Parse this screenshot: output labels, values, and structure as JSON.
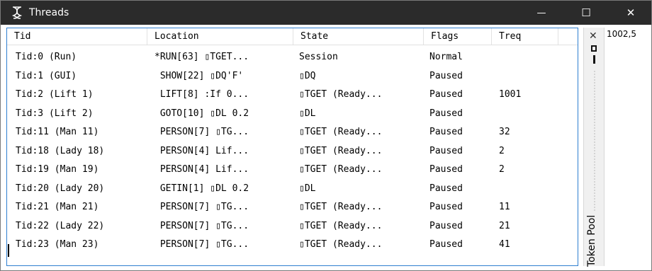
{
  "window": {
    "title": "Threads",
    "controls": {
      "minimize": "—",
      "maximize": "☐",
      "close": "✕"
    }
  },
  "columns": [
    "Tid",
    "Location",
    "State",
    "Flags",
    "Treq"
  ],
  "rows": [
    {
      "tid": "Tid:0 (Run)",
      "location": "*RUN[63] ▯TGET...",
      "state": "Session",
      "flags": "Normal",
      "treq": ""
    },
    {
      "tid": "Tid:1 (GUI)",
      "location": " SHOW[22] ▯DQ'F'",
      "state": "▯DQ",
      "flags": "Paused",
      "treq": ""
    },
    {
      "tid": "Tid:2 (Lift 1)",
      "location": " LIFT[8] :If 0...",
      "state": "▯TGET (Ready...",
      "flags": "Paused",
      "treq": "1001"
    },
    {
      "tid": "Tid:3 (Lift 2)",
      "location": " GOTO[10] ▯DL 0.2",
      "state": "▯DL",
      "flags": "Paused",
      "treq": ""
    },
    {
      "tid": "Tid:11 (Man 11)",
      "location": " PERSON[7] ▯TG...",
      "state": "▯TGET (Ready...",
      "flags": "Paused",
      "treq": "32"
    },
    {
      "tid": "Tid:18 (Lady 18)",
      "location": " PERSON[4] Lif...",
      "state": "▯TGET (Ready...",
      "flags": "Paused",
      "treq": "2"
    },
    {
      "tid": "Tid:19 (Man 19)",
      "location": " PERSON[4] Lif...",
      "state": "▯TGET (Ready...",
      "flags": "Paused",
      "treq": "2"
    },
    {
      "tid": "Tid:20 (Lady 20)",
      "location": " GETIN[1] ▯DL 0.2",
      "state": "▯DL",
      "flags": "Paused",
      "treq": ""
    },
    {
      "tid": "Tid:21 (Man 21)",
      "location": " PERSON[7] ▯TG...",
      "state": "▯TGET (Ready...",
      "flags": "Paused",
      "treq": "11"
    },
    {
      "tid": "Tid:22 (Lady 22)",
      "location": " PERSON[7] ▯TG...",
      "state": "▯TGET (Ready...",
      "flags": "Paused",
      "treq": "21"
    },
    {
      "tid": "Tid:23 (Man 23)",
      "location": " PERSON[7] ▯TG...",
      "state": "▯TGET (Ready...",
      "flags": "Paused",
      "treq": "41"
    }
  ],
  "token_pool": {
    "label": "Token Pool",
    "close": "✕"
  },
  "side_value": "1002,5",
  "colors": {
    "titlebar": "#2b2b2b",
    "focus_border": "#2f7fd0"
  }
}
